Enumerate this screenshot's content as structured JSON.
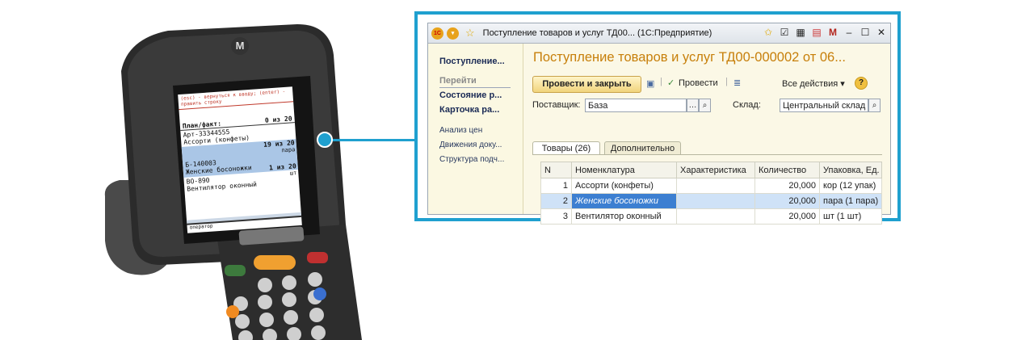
{
  "scanner": {
    "brand_glyph": "M",
    "hint": "(esc) - вернуться к вводу; (enter) - править строку",
    "list_title": "План/факт:",
    "list_total": "0 из 20",
    "items": [
      {
        "code": "Арт-33344555",
        "name": "Ассорти (конфеты)",
        "count": "19 из 20",
        "unit": "пара"
      },
      {
        "code": "Б-140003",
        "name": "Женские босоножки",
        "count": "1 из 20",
        "unit": "шт"
      },
      {
        "code": "ВО-890",
        "name": "Вентилятор оконный",
        "count": "",
        "unit": ""
      }
    ],
    "footer": "оператор"
  },
  "window": {
    "title": "Поступление товаров и услуг ТД00...  (1С:Предприятие)",
    "icon_1c": "1С",
    "sidebar": {
      "current": "Поступление...",
      "goto_header": "Перейти",
      "goto_items": [
        "Состояние р...",
        "Карточка ра..."
      ],
      "links": [
        "Анализ цен",
        "Движения доку...",
        "Структура подч..."
      ]
    },
    "doc_title": "Поступление товаров и услуг ТД00-000002 от 06...",
    "toolbar": {
      "post_close": "Провести и закрыть",
      "post": "Провести",
      "all_actions": "Все действия",
      "help": "?"
    },
    "form": {
      "supplier_label": "Поставщик:",
      "supplier_value": "База",
      "warehouse_label": "Склад:",
      "warehouse_value": "Центральный склад"
    },
    "tabs": [
      "Товары (26)",
      "Дополнительно"
    ],
    "table": {
      "columns": [
        "N",
        "Номенклатура",
        "Характеристика",
        "Количество",
        "Упаковка, Ед."
      ],
      "rows": [
        {
          "n": "1",
          "name": "Ассорти (конфеты)",
          "char": "",
          "qty": "20,000",
          "pack": "кор (12 упак)"
        },
        {
          "n": "2",
          "name": "Женские босоножки",
          "char": "",
          "qty": "20,000",
          "pack": "пара (1 пара)"
        },
        {
          "n": "3",
          "name": "Вентилятор оконный",
          "char": "",
          "qty": "20,000",
          "pack": "шт (1 шт)"
        }
      ],
      "selected_row": 2
    }
  },
  "colors": {
    "accent": "#1fa0cf",
    "title_orange": "#c77f0a",
    "selection": "#3c7fd1"
  }
}
